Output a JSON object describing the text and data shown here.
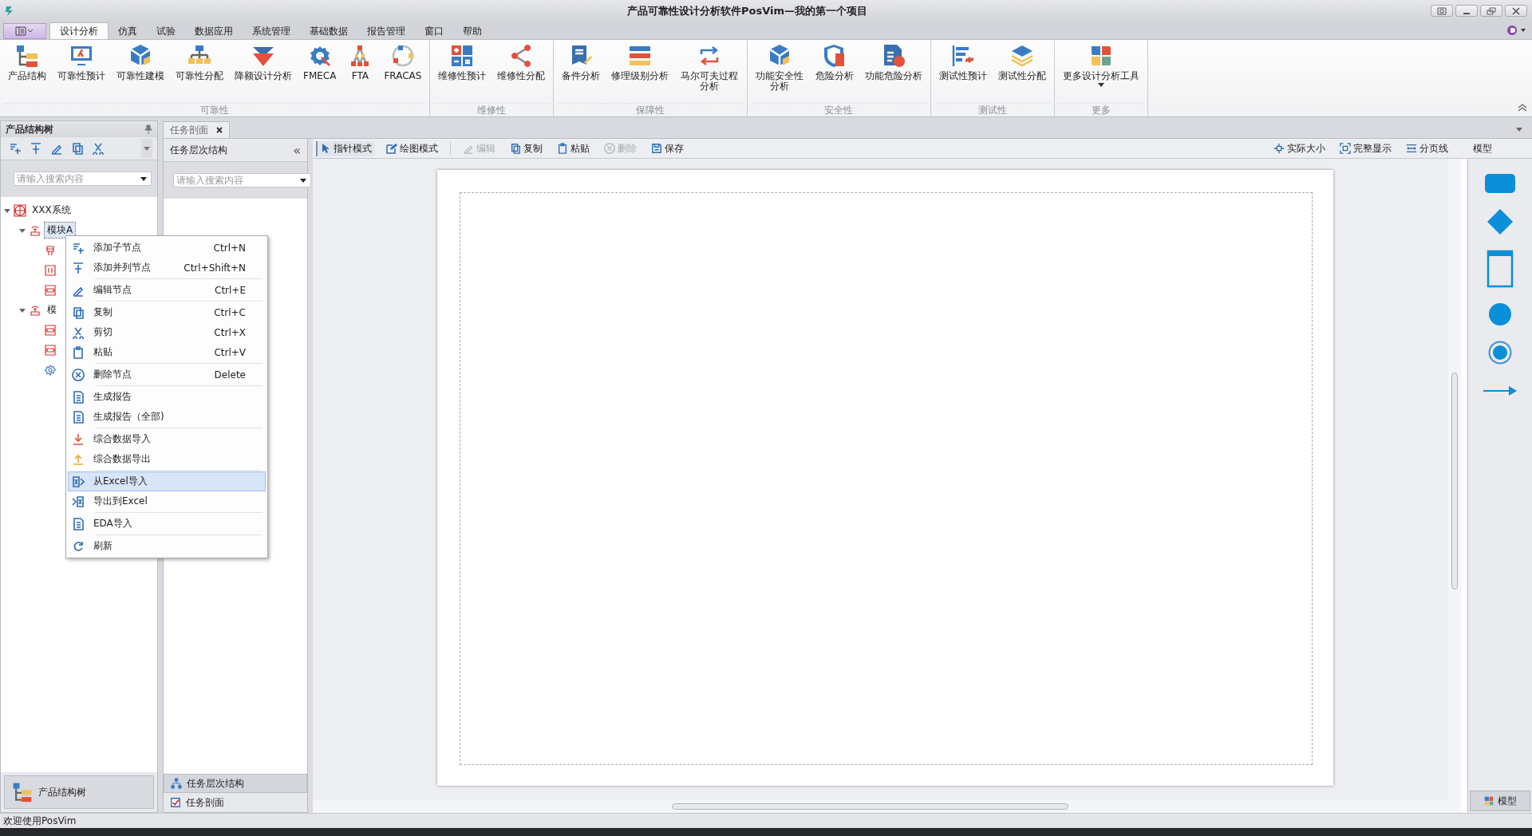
{
  "window": {
    "title": "产品可靠性设计分析软件PosVim—我的第一个项目"
  },
  "menu_tabs": [
    {
      "label": "设计分析",
      "selected": true
    },
    {
      "label": "仿真",
      "selected": false
    },
    {
      "label": "试验",
      "selected": false
    },
    {
      "label": "数据应用",
      "selected": false
    },
    {
      "label": "系统管理",
      "selected": false
    },
    {
      "label": "基础数据",
      "selected": false
    },
    {
      "label": "报告管理",
      "selected": false
    },
    {
      "label": "窗口",
      "selected": false
    },
    {
      "label": "帮助",
      "selected": false
    }
  ],
  "ribbon": [
    {
      "label": "可靠性",
      "buttons": [
        {
          "label": "产品结构"
        },
        {
          "label": "可靠性预计"
        },
        {
          "label": "可靠性建模"
        },
        {
          "label": "可靠性分配"
        },
        {
          "label": "降额设计分析"
        },
        {
          "label": "FMECA"
        },
        {
          "label": "FTA"
        },
        {
          "label": "FRACAS"
        }
      ]
    },
    {
      "label": "维修性",
      "buttons": [
        {
          "label": "维修性预计"
        },
        {
          "label": "维修性分配"
        }
      ]
    },
    {
      "label": "保障性",
      "buttons": [
        {
          "label": "备件分析"
        },
        {
          "label": "修理级别分析"
        },
        {
          "label": "马尔可夫过程分析"
        }
      ]
    },
    {
      "label": "安全性",
      "buttons": [
        {
          "label": "功能安全性分析"
        },
        {
          "label": "危险分析"
        },
        {
          "label": "功能危险分析"
        }
      ]
    },
    {
      "label": "测试性",
      "buttons": [
        {
          "label": "测试性预计"
        },
        {
          "label": "测试性分配"
        }
      ]
    },
    {
      "label": "更多",
      "buttons": [
        {
          "label": "更多设计分析工具"
        }
      ]
    }
  ],
  "left_panel": {
    "title": "产品结构树",
    "search": {
      "placeholder": "请输入搜索内容"
    },
    "tree": [
      {
        "label": "XXX系统",
        "kind": "system",
        "expanded": true,
        "selected": false,
        "children": [
          {
            "label": "模块A",
            "kind": "module",
            "expanded": true,
            "selected": true,
            "children": [
              {
                "kind": "connector"
              },
              {
                "kind": "chip"
              },
              {
                "kind": "resistor"
              }
            ]
          },
          {
            "label": "模",
            "kind": "module",
            "expanded": true,
            "selected": false,
            "children": [
              {
                "kind": "resistor"
              },
              {
                "kind": "resistor"
              },
              {
                "kind": "gear"
              }
            ]
          }
        ]
      }
    ],
    "bottom_button": "产品结构树"
  },
  "document_tab": {
    "label": "任务剖面"
  },
  "middle_panel": {
    "title": "任务层次结构",
    "collapse": "«",
    "search": {
      "placeholder": "请输入搜索内容"
    },
    "bottom_items": [
      {
        "label": "任务层次结构",
        "selected": true
      },
      {
        "label": "任务剖面",
        "selected": false
      }
    ]
  },
  "canvas_toolbar": {
    "modes": [
      {
        "label": "指针模式",
        "selected": true
      },
      {
        "label": "绘图模式",
        "selected": false
      }
    ],
    "actions": [
      {
        "label": "编辑",
        "disabled": true
      },
      {
        "label": "复制",
        "disabled": false
      },
      {
        "label": "粘贴",
        "disabled": false
      },
      {
        "label": "删除",
        "disabled": true
      },
      {
        "label": "保存",
        "disabled": false
      }
    ],
    "view_actions": [
      {
        "label": "实际大小"
      },
      {
        "label": "完整显示"
      },
      {
        "label": "分页线"
      }
    ],
    "palette_title": "模型"
  },
  "palette": {
    "button": "模型"
  },
  "context_menu": {
    "groups": [
      [
        {
          "label": "添加子节点",
          "shortcut": "Ctrl+N",
          "selected": false
        },
        {
          "label": "添加并列节点",
          "shortcut": "Ctrl+Shift+N",
          "selected": false
        }
      ],
      [
        {
          "label": "编辑节点",
          "shortcut": "Ctrl+E",
          "selected": false
        }
      ],
      [
        {
          "label": "复制",
          "shortcut": "Ctrl+C",
          "selected": false
        },
        {
          "label": "剪切",
          "shortcut": "Ctrl+X",
          "selected": false
        },
        {
          "label": "粘贴",
          "shortcut": "Ctrl+V",
          "selected": false
        }
      ],
      [
        {
          "label": "删除节点",
          "shortcut": "Delete",
          "selected": false
        }
      ],
      [
        {
          "label": "生成报告",
          "selected": false
        },
        {
          "label": "生成报告（全部)",
          "selected": false
        }
      ],
      [
        {
          "label": "综合数据导入",
          "selected": false
        },
        {
          "label": "综合数据导出",
          "selected": false
        }
      ],
      [
        {
          "label": "从Excel导入",
          "selected": true
        },
        {
          "label": "导出到Excel",
          "selected": false
        }
      ],
      [
        {
          "label": "EDA导入",
          "selected": false
        }
      ],
      [
        {
          "label": "刷新",
          "selected": false
        }
      ]
    ]
  },
  "status_bar": {
    "text": "欢迎使用PosVim"
  }
}
